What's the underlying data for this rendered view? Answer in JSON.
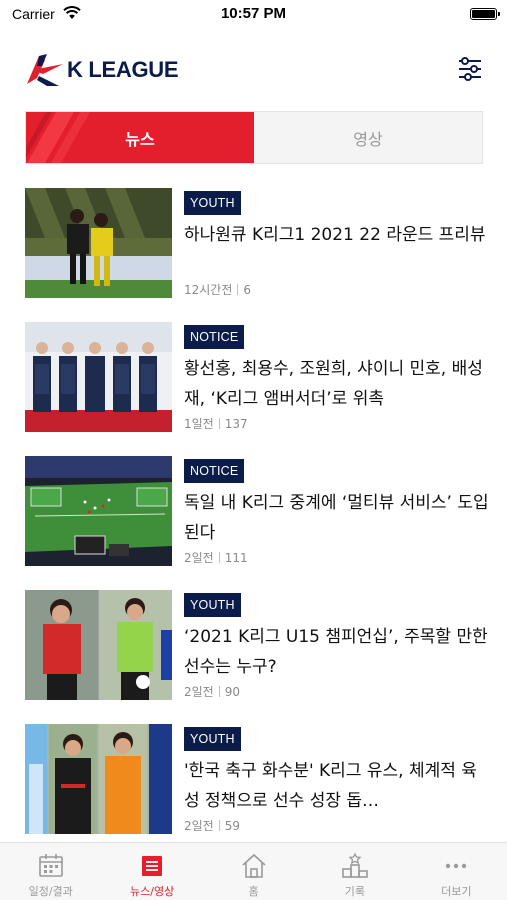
{
  "status_bar": {
    "carrier": "Carrier",
    "time": "10:57 PM"
  },
  "header": {
    "logo_text": "K LEAGUE",
    "settings_icon": "settings-sliders-icon"
  },
  "tabs": [
    {
      "label": "뉴스",
      "active": true
    },
    {
      "label": "영상",
      "active": false
    }
  ],
  "news": [
    {
      "badge": "YOUTH",
      "title": "하나원큐 K리그1 2021 22 라운드 프리뷰",
      "time": "12시간전",
      "views": "6"
    },
    {
      "badge": "NOTICE",
      "title": "황선홍, 최용수, 조원희, 샤이니 민호, 배성재, ‘K리그 앰버서더’로 위촉",
      "time": "1일전",
      "views": "137"
    },
    {
      "badge": "NOTICE",
      "title": "독일 내 K리그 중계에 ‘멀티뷰 서비스’ 도입된다",
      "time": "2일전",
      "views": "111"
    },
    {
      "badge": "YOUTH",
      "title": "‘2021 K리그 U15 챔피언십’, 주목할 만한 선수는 누구?",
      "time": "2일전",
      "views": "90"
    },
    {
      "badge": "YOUTH",
      "title": "'한국 축구 화수분' K리그 유스, 체계적 육성 정책으로 선수 성장 돕…",
      "time": "2일전",
      "views": "59"
    }
  ],
  "bottom_nav": [
    {
      "label": "일정/결과",
      "icon": "calendar-icon"
    },
    {
      "label": "뉴스/영상",
      "icon": "news-icon",
      "active": true
    },
    {
      "label": "홈",
      "icon": "home-icon"
    },
    {
      "label": "기록",
      "icon": "podium-icon"
    },
    {
      "label": "더보기",
      "icon": "more-icon"
    }
  ],
  "colors": {
    "accent": "#e41f2d",
    "navy": "#0b1c4a",
    "inactive": "#9a9a9a"
  }
}
